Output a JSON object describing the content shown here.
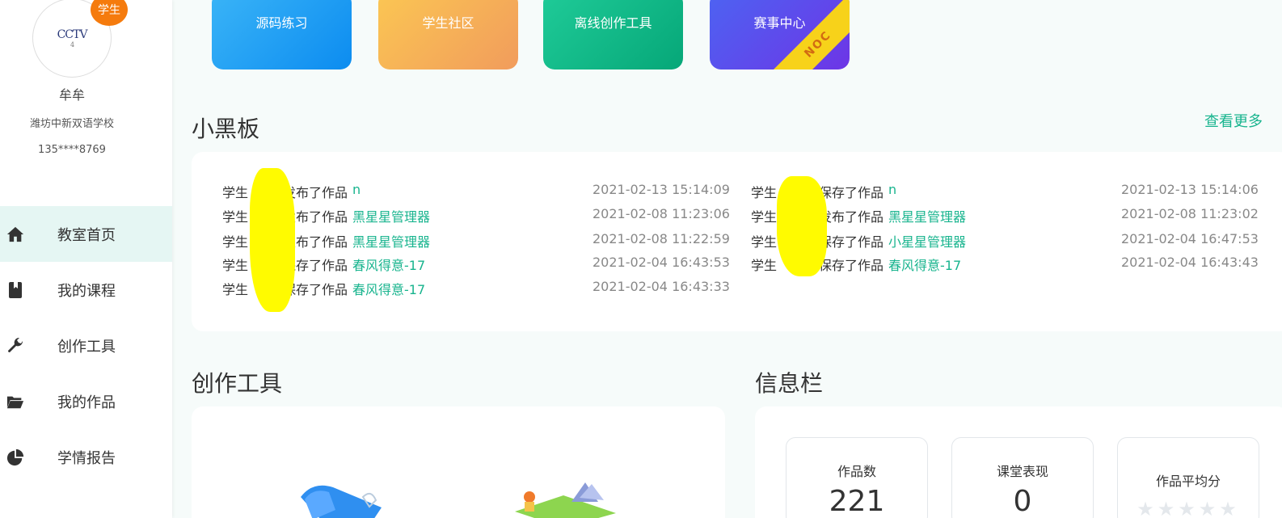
{
  "user": {
    "role_badge": "学生",
    "avatar_logo": "CCTV",
    "avatar_sub": "4",
    "name": "牟牟",
    "school": "潍坊中新双语学校",
    "phone": "135****8769"
  },
  "nav": [
    {
      "label": "教室首页",
      "icon": "home-icon",
      "active": true
    },
    {
      "label": "我的课程",
      "icon": "book-icon",
      "active": false
    },
    {
      "label": "创作工具",
      "icon": "wrench-icon",
      "active": false
    },
    {
      "label": "我的作品",
      "icon": "folder-icon",
      "active": false
    },
    {
      "label": "学情报告",
      "icon": "pie-chart-icon",
      "active": false
    }
  ],
  "tiles": [
    {
      "label": "源码练习"
    },
    {
      "label": "学生社区"
    },
    {
      "label": "离线创作工具"
    },
    {
      "label": "赛事中心",
      "ribbon": "NOC"
    }
  ],
  "blackboard": {
    "title": "小黑板",
    "more": "查看更多",
    "left": [
      {
        "prefix": "学生",
        "action": "发布了作品",
        "work": "n",
        "time": "2021-02-13 15:14:09"
      },
      {
        "prefix": "学生",
        "action": "发布了作品",
        "work": "黑星星管理器",
        "time": "2021-02-08 11:23:06"
      },
      {
        "prefix": "学生",
        "action": "发布了作品",
        "work": "黑星星管理器",
        "time": "2021-02-08 11:22:59"
      },
      {
        "prefix": "学生",
        "action": "保存了作品",
        "work": "春风得意-17",
        "time": "2021-02-04 16:43:53"
      },
      {
        "prefix": "学生",
        "action": "保存了作品",
        "work": "春风得意-17",
        "time": "2021-02-04 16:43:33"
      }
    ],
    "right": [
      {
        "prefix": "学生",
        "action": "保存了作品",
        "work": "n",
        "time": "2021-02-13 15:14:06"
      },
      {
        "prefix": "学生",
        "action": "发布了作品",
        "work": "黑星星管理器",
        "time": "2021-02-08 11:23:02"
      },
      {
        "prefix": "学生",
        "action": "保存了作品",
        "work": "小星星管理器",
        "time": "2021-02-04 16:47:53"
      },
      {
        "prefix": "学生",
        "action": "保存了作品",
        "work": "春风得意-17",
        "time": "2021-02-04 16:43:43"
      }
    ]
  },
  "tools": {
    "title": "创作工具"
  },
  "info": {
    "title": "信息栏",
    "works_label": "作品数",
    "works_value": "221",
    "class_label": "课堂表现",
    "class_value": "0",
    "avg_label": "作品平均分",
    "avg_stars": 0
  }
}
